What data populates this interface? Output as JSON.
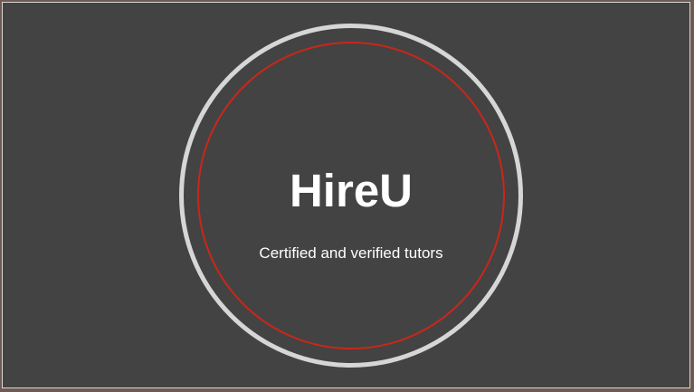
{
  "brand": {
    "name": "HireU",
    "tagline": "Certified and verified tutors"
  },
  "colors": {
    "background": "#434343",
    "outer_ring": "#d6d6d6",
    "inner_ring": "#c9271a",
    "text": "#ffffff"
  }
}
